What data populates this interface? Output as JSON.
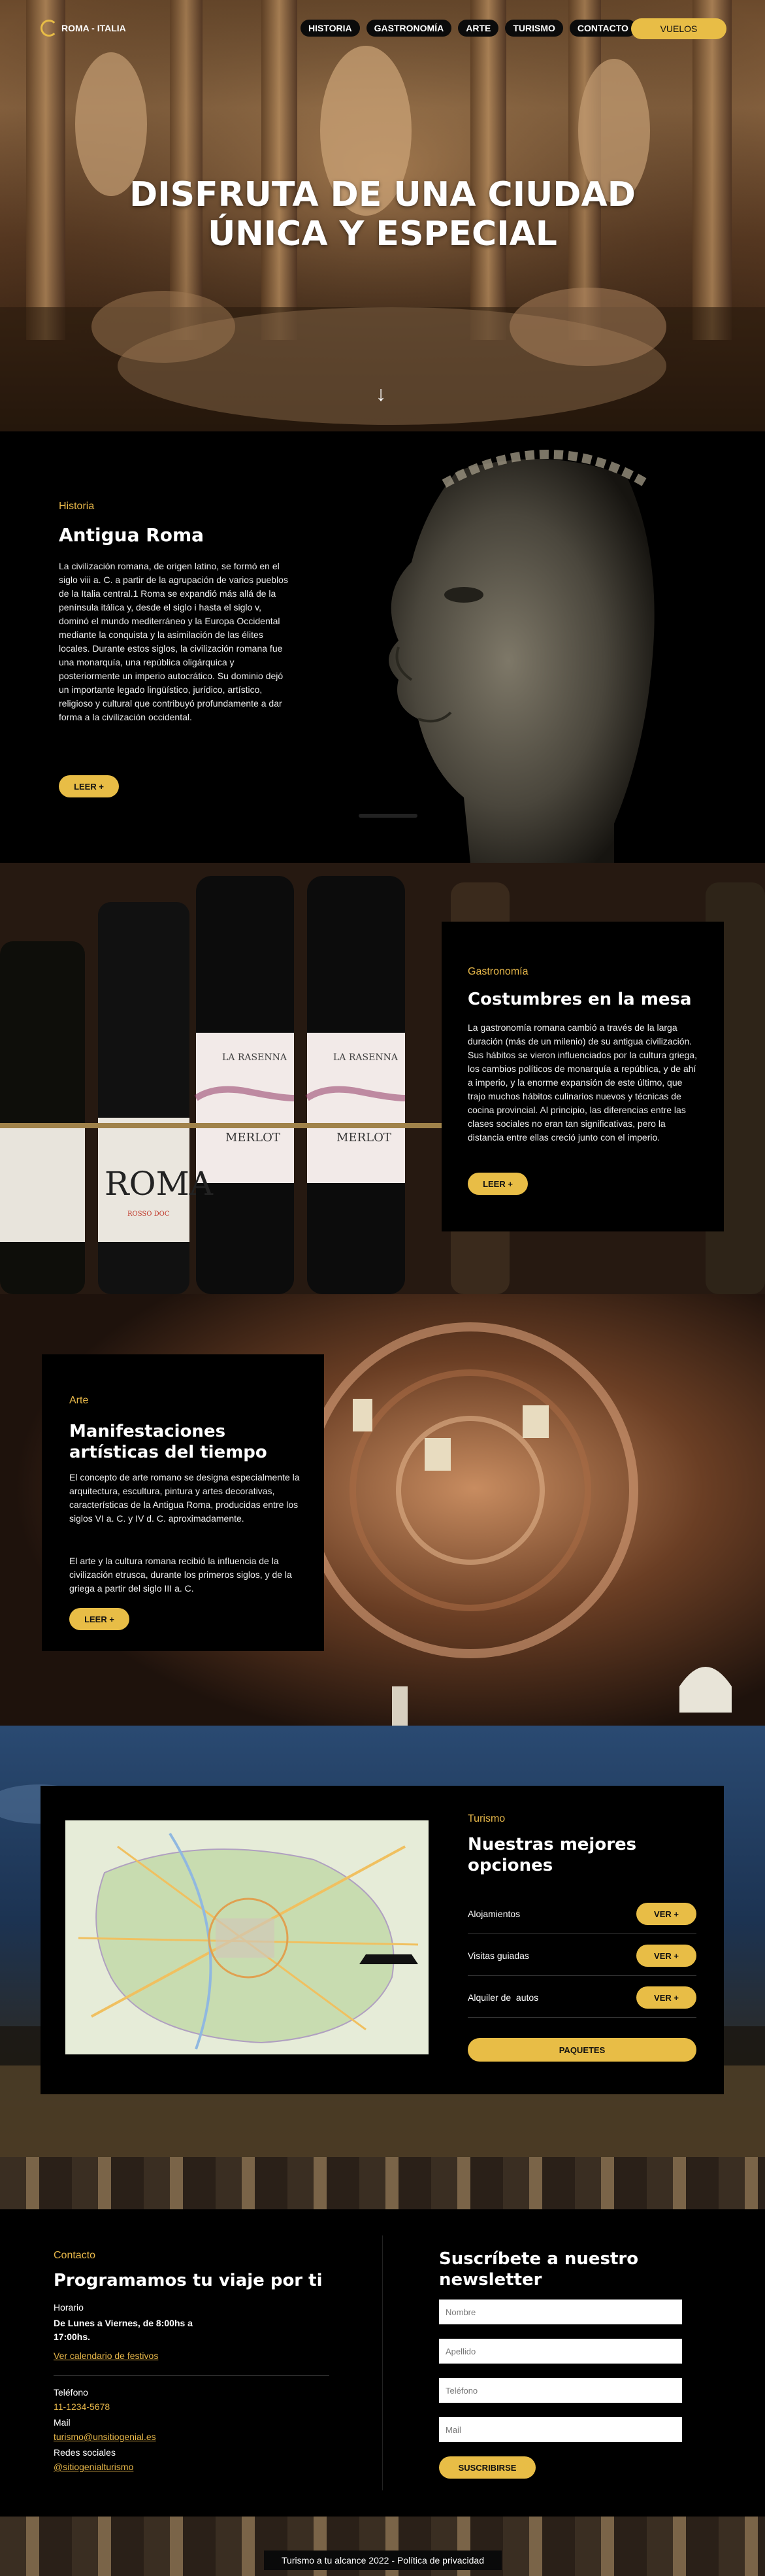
{
  "header": {
    "brand": "ROMA - ITALIA",
    "nav": [
      "HISTORIA",
      "GASTRONOMÍA",
      "ARTE",
      "TURISMO",
      "CONTACTO"
    ],
    "cta": "VUELOS"
  },
  "hero": {
    "title_line1": "DISFRUTA DE UNA CIUDAD",
    "title_line2": "ÚNICA Y ESPECIAL",
    "scroll_arrow": "↓"
  },
  "historia": {
    "eyebrow": "Historia",
    "title": "Antigua Roma",
    "text": "La civilización romana, de origen latino, se formó en el siglo viii a. C. a partir de la agrupación de varios pueblos de la Italia central.1 Roma se expandió más allá de la península itálica y, desde el siglo i hasta el siglo v, dominó el mundo mediterráneo y la Europa Occidental mediante la conquista y la asimilación de las élites locales. Durante estos siglos, la civilización romana fue una monarquía, una república oligárquica y posteriormente un imperio autocrático. Su dominio dejó un importante legado lingüístico, jurídico, artístico, religioso y cultural que contribuyó profundamente a dar forma a la civilización occidental.",
    "button": "LEER +"
  },
  "gastronomia": {
    "eyebrow": "Gastronomía",
    "title": "Costumbres en la mesa",
    "text": "La gastronomía romana cambió a través de la larga duración (más de un milenio) de su antigua civilización. Sus hábitos se vieron influenciados por la cultura griega, los cambios políticos de monarquía a república, y de ahí a imperio, y la enorme expansión de este último, que trajo muchos hábitos culinarios nuevos y técnicas de cocina provincial. Al principio, las diferencias entre las clases sociales no eran tan significativas, pero la distancia entre ellas creció junto con el imperio.",
    "button": "LEER +",
    "bottle_labels": [
      "ROMA",
      "LA RASENNA",
      "MERLOT",
      "LA RASENNA",
      "MERLOT",
      "ROSSO DOC"
    ]
  },
  "arte": {
    "eyebrow": "Arte",
    "title": "Manifestaciones artísticas del tiempo",
    "text1": "El concepto de arte romano se designa especialmente la arquitectura, escultura, pintura y artes decorativas, características de la Antigua Roma, producidas entre los siglos VI a. C. y IV d. C. aproximadamente.",
    "text2": "El arte y la cultura romana recibió la influencia de la civilización etrusca, durante los primeros siglos, y de la griega a partir del siglo III a. C.",
    "button": "LEER +"
  },
  "turismo": {
    "eyebrow": "Turismo",
    "title": "Nuestras mejores opciones",
    "options": [
      {
        "label": "Alojamientos",
        "button": "VER +"
      },
      {
        "label": "Visitas guiadas",
        "button": "VER +"
      },
      {
        "label": "Alquiler de  autos",
        "button": "VER +"
      }
    ],
    "packages_button": "PAQUETES"
  },
  "contacto": {
    "eyebrow": "Contacto",
    "title": "Programamos tu viaje por ti",
    "horario_label": "Horario",
    "horario_value": "De Lunes a Viernes, de 8:00hs a 17:00hs.",
    "calendar_link": "Ver calendario de festivos",
    "telefono_label": "Teléfono",
    "telefono_value": "11-1234-5678",
    "mail_label": "Mail",
    "mail_value": "turismo@unsitiogenial.es",
    "redes_label": "Redes sociales",
    "redes_value": "@sitiogenialturismo"
  },
  "newsletter": {
    "title": "Suscríbete a nuestro newsletter",
    "placeholders": [
      "Nombre",
      "Apellido",
      "Teléfono",
      "Mail"
    ],
    "button": "SUSCRIBIRSE"
  },
  "footer": {
    "text": "Turismo a tu alcance 2022 - Política de privacidad"
  },
  "colors": {
    "accent": "#e8bd46",
    "panel": "#0b0b0b",
    "background": "#000000"
  }
}
